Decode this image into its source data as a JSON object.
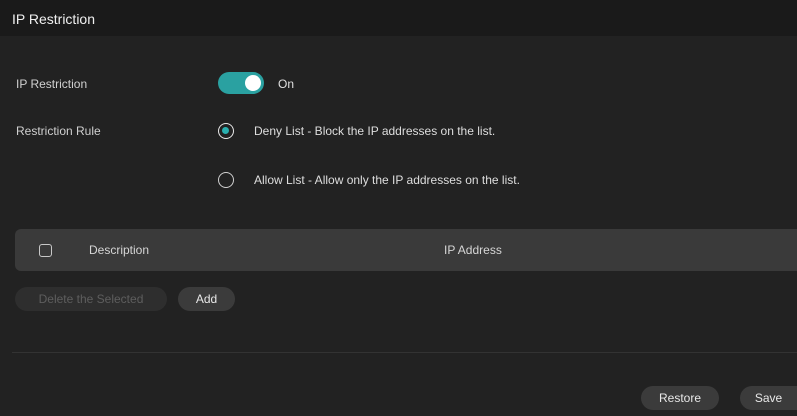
{
  "panel": {
    "title": "IP Restriction"
  },
  "ip_restriction": {
    "label": "IP Restriction",
    "state_text": "On",
    "enabled": true
  },
  "restriction_rule": {
    "label": "Restriction Rule",
    "options": [
      {
        "label": "Deny List - Block the IP addresses on the list.",
        "selected": true
      },
      {
        "label": "Allow List - Allow only the IP addresses on the list.",
        "selected": false
      }
    ]
  },
  "table": {
    "columns": [
      "Description",
      "IP Address"
    ],
    "rows": []
  },
  "actions": {
    "delete_selected": "Delete the Selected",
    "add": "Add"
  },
  "footer": {
    "restore": "Restore",
    "save": "Save"
  },
  "colors": {
    "accent": "#2aa1a1",
    "background": "#222222",
    "header_bg": "#1a1a1a"
  }
}
